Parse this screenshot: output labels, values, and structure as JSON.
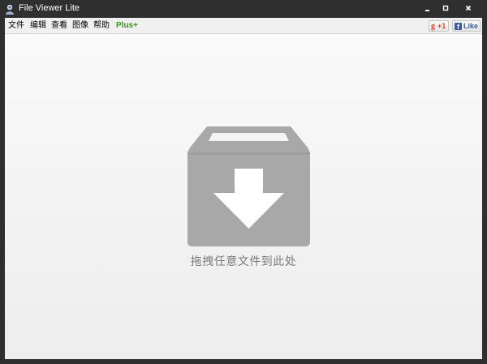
{
  "window": {
    "title": "File Viewer Lite",
    "minimize_icon": "minimize-icon",
    "maximize_icon": "maximize-icon",
    "close_icon": "close-icon"
  },
  "menu": {
    "items": [
      "文件",
      "编辑",
      "查看",
      "图像",
      "帮助"
    ],
    "plus_label": "Plus+"
  },
  "social": {
    "gplus_logo": "g",
    "gplus_count": "+1",
    "facebook_logo": "f",
    "facebook_label": "Like"
  },
  "drop_zone": {
    "icon": "box-download-icon",
    "label": "拖拽任意文件到此处"
  },
  "colors": {
    "titlebar": "#2f2f2f",
    "plus_accent": "#3a9a1a",
    "icon_gray": "#a8a8a8",
    "facebook_blue": "#3b5998",
    "gplus_red": "#d8452d"
  }
}
